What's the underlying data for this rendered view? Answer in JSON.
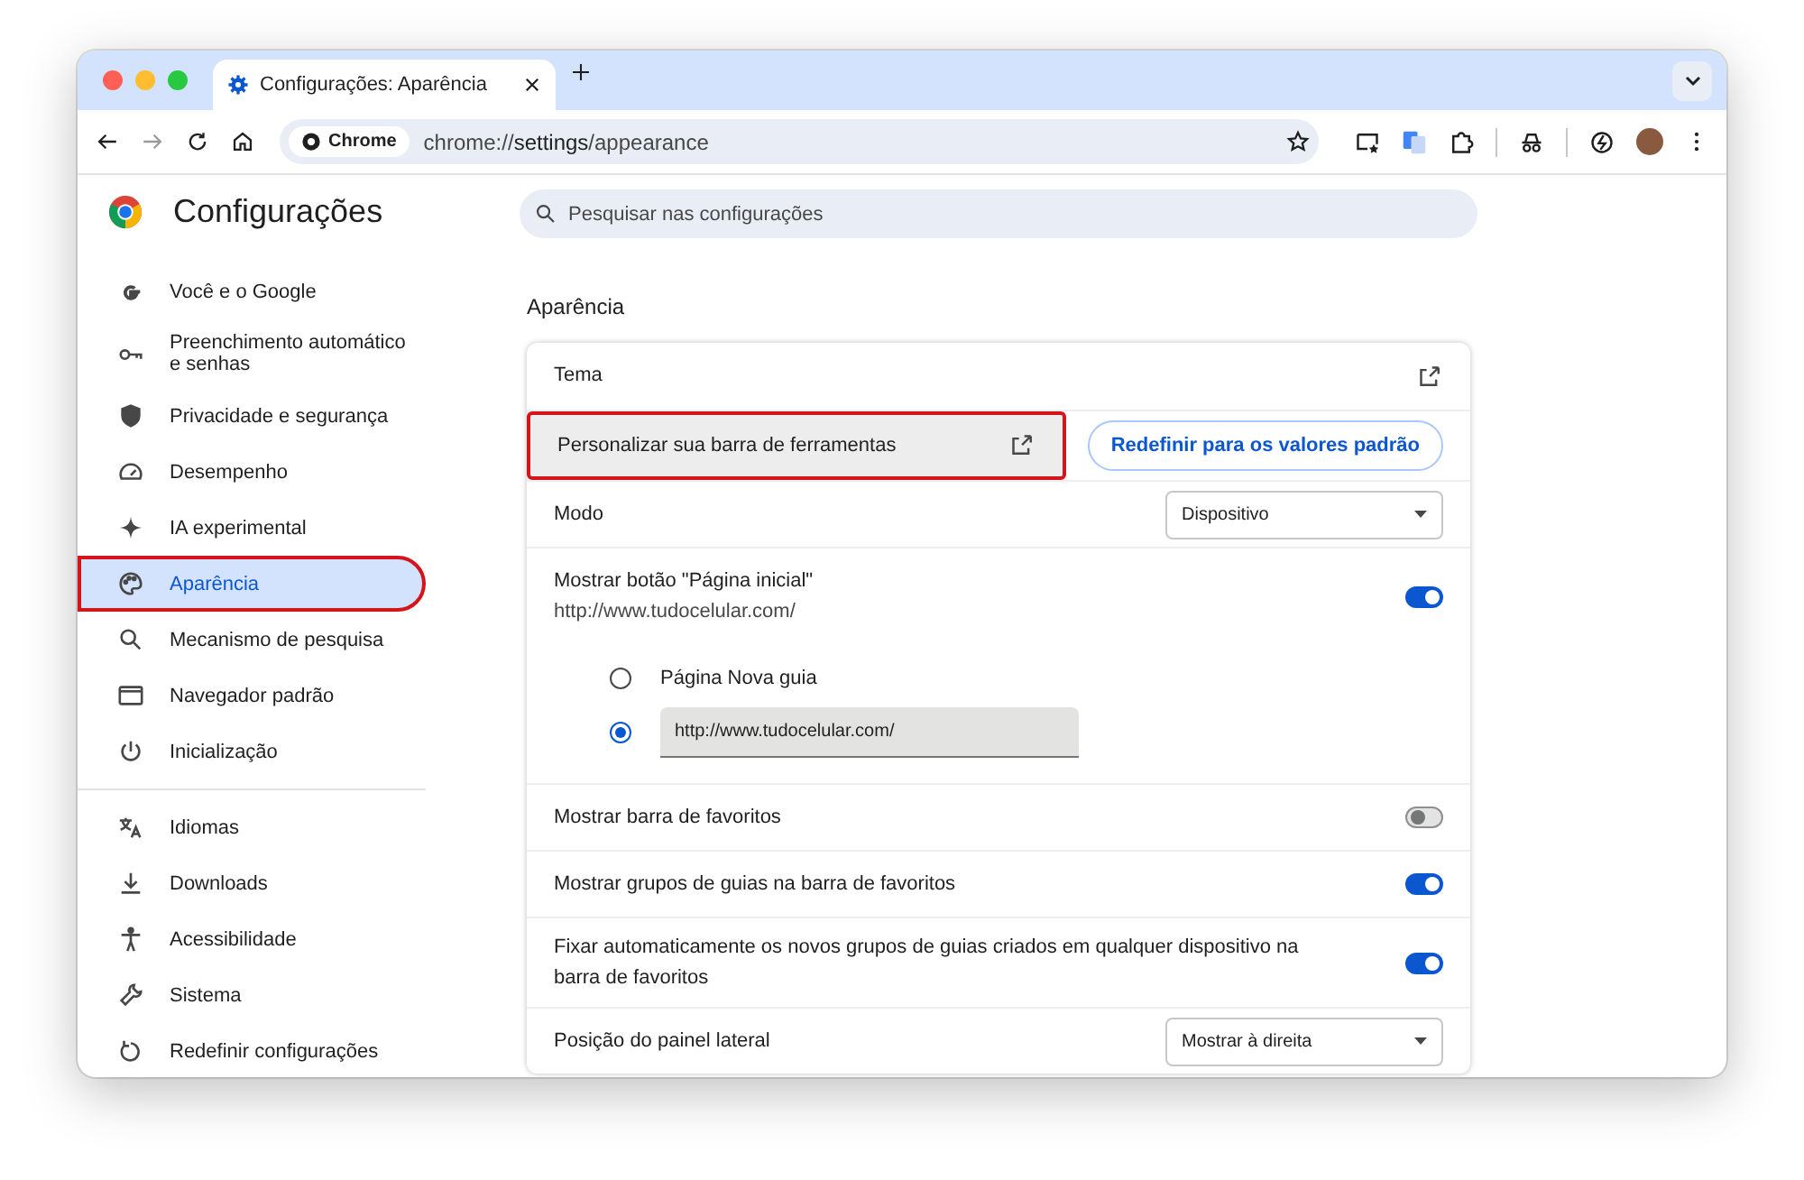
{
  "tab": {
    "title": "Configurações: Aparência"
  },
  "toolbar": {
    "chip": "Chrome",
    "url": "chrome://**settings**/appearance"
  },
  "sidebar": {
    "title": "Configurações",
    "groups": [
      [
        {
          "label": "Você e o Google",
          "selected": false,
          "highlighted": false
        },
        {
          "label": "Preenchimento automático e senhas",
          "selected": false,
          "highlighted": false
        },
        {
          "label": "Privacidade e segurança",
          "selected": false,
          "highlighted": false
        },
        {
          "label": "Desempenho",
          "selected": false,
          "highlighted": false
        },
        {
          "label": "IA experimental",
          "selected": false,
          "highlighted": false
        },
        {
          "label": "Aparência",
          "selected": true,
          "highlighted": true
        },
        {
          "label": "Mecanismo de pesquisa",
          "selected": false,
          "highlighted": false
        },
        {
          "label": "Navegador padrão",
          "selected": false,
          "highlighted": false
        },
        {
          "label": "Inicialização",
          "selected": false,
          "highlighted": false
        }
      ],
      [
        {
          "label": "Idiomas",
          "selected": false,
          "highlighted": false
        },
        {
          "label": "Downloads",
          "selected": false,
          "highlighted": false
        },
        {
          "label": "Acessibilidade",
          "selected": false,
          "highlighted": false
        },
        {
          "label": "Sistema",
          "selected": false,
          "highlighted": false
        },
        {
          "label": "Redefinir configurações",
          "selected": false,
          "highlighted": false
        }
      ]
    ]
  },
  "search": {
    "placeholder": "Pesquisar nas configurações"
  },
  "section": {
    "title": "Aparência"
  },
  "rows": [
    {
      "kind": "link",
      "label": "Tema"
    },
    {
      "kind": "link_button",
      "label": "Personalizar sua barra de ferramentas",
      "highlighted": true,
      "button": "Redefinir para os valores padrão"
    },
    {
      "kind": "select",
      "label": "Modo",
      "value": "Dispositivo"
    },
    {
      "kind": "toggle_radios",
      "label": "Mostrar botão \"Página inicial\"",
      "sublabel": "http://www.tudocelular.com/",
      "on": true,
      "options": [
        {
          "label": "Página Nova guia",
          "selected": false
        },
        {
          "value": "http://www.tudocelular.com/",
          "selected": true
        }
      ]
    },
    {
      "kind": "toggle",
      "label": "Mostrar barra de favoritos",
      "on": false
    },
    {
      "kind": "toggle",
      "label": "Mostrar grupos de guias na barra de favoritos",
      "on": true
    },
    {
      "kind": "toggle",
      "label": "Fixar automaticamente os novos grupos de guias criados em qualquer dispositivo na barra de favoritos",
      "on": true
    },
    {
      "kind": "select",
      "label": "Posição do painel lateral",
      "value": "Mostrar à direita"
    }
  ]
}
